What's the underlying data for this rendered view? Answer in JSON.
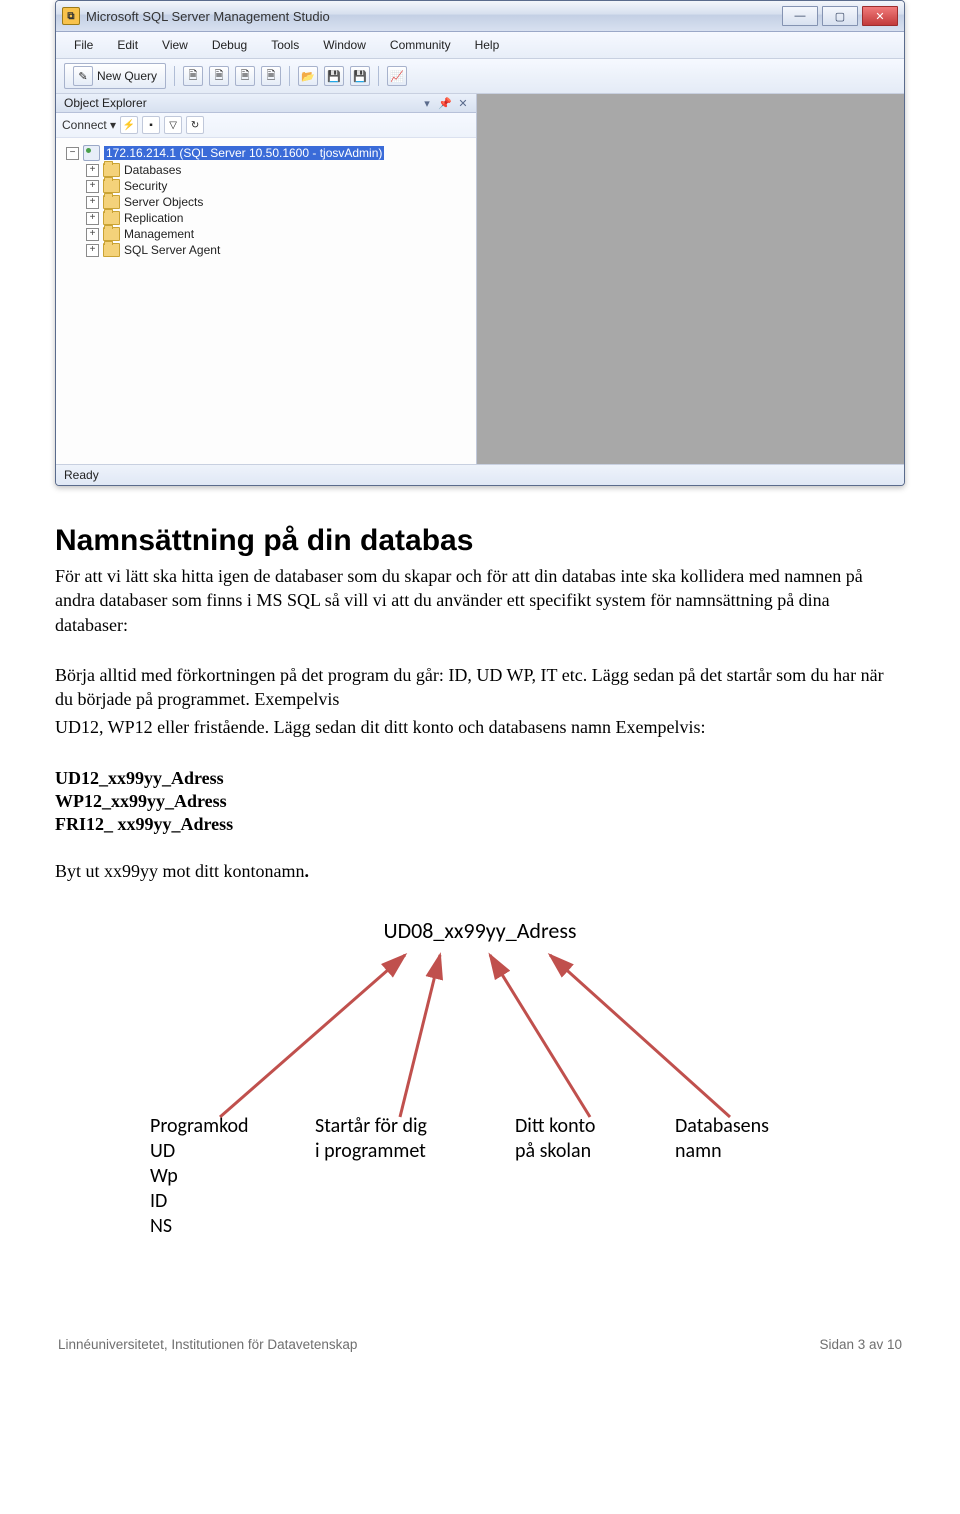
{
  "ssms": {
    "title": "Microsoft SQL Server Management Studio",
    "menus": [
      "File",
      "Edit",
      "View",
      "Debug",
      "Tools",
      "Window",
      "Community",
      "Help"
    ],
    "new_query_label": "New Query",
    "object_explorer": {
      "title": "Object Explorer",
      "connect_label": "Connect ▾",
      "root": "172.16.214.1 (SQL Server 10.50.1600 - tjosvAdmin)",
      "children": [
        "Databases",
        "Security",
        "Server Objects",
        "Replication",
        "Management",
        "SQL Server Agent"
      ]
    },
    "status": "Ready"
  },
  "heading": "Namnsättning på din databas",
  "body": {
    "p1": "För att vi lätt ska hitta igen de databaser som du skapar och för att din databas inte ska kollidera med namnen på andra databaser som finns i MS SQL så vill vi att du använder ett specifikt system för namnsättning på dina databaser:",
    "p2": "Börja alltid med förkortningen på det program du går: ID, UD WP, IT etc. Lägg sedan på det startår som du har när du började på programmet. Exempelvis",
    "p3": "UD12, WP12 eller fristående. Lägg sedan dit ditt konto och databasens namn Exempelvis:",
    "examples": [
      "UD12_xx99yy_Adress",
      "WP12_xx99yy_Adress",
      "FRI12_ xx99yy_Adress"
    ],
    "p4_prefix": "Byt ut xx99yy mot ditt kontonamn",
    "p4_dot": "."
  },
  "diagram": {
    "top": "UD08_xx99yy_Adress",
    "col1": {
      "title": "Programkod",
      "lines": [
        "UD",
        "Wp",
        "ID",
        "NS"
      ]
    },
    "col2": {
      "line1": "Startår för dig",
      "line2": "i programmet"
    },
    "col3": {
      "line1": "Ditt konto",
      "line2": "på skolan"
    },
    "col4": {
      "line1": "Databasens",
      "line2": "namn"
    }
  },
  "footer": {
    "left": "Linnéuniversitetet, Institutionen för Datavetenskap",
    "right": "Sidan 3 av 10"
  }
}
